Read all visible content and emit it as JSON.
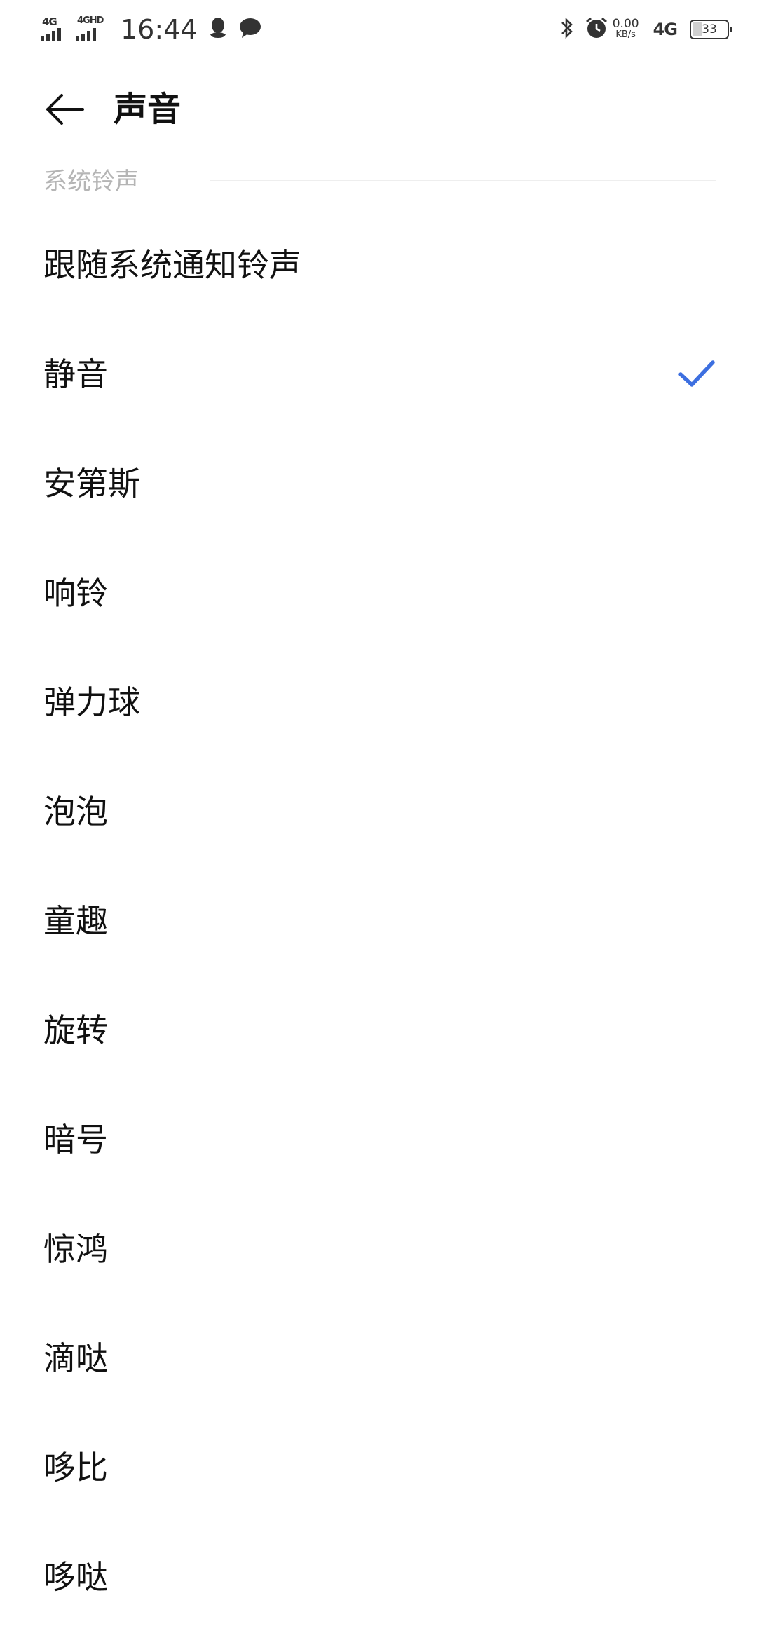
{
  "status_bar": {
    "sim1_net": "4G",
    "sim2_net": "4GHD",
    "time": "16:44",
    "speed_value": "0.00",
    "speed_unit": "KB/s",
    "net_type": "4G",
    "battery_level": "33",
    "icons": [
      "qq-icon",
      "message-icon",
      "bluetooth-icon",
      "alarm-icon"
    ]
  },
  "header": {
    "title": "声音"
  },
  "section": {
    "label": "系统铃声"
  },
  "ringtones": [
    {
      "label": "跟随系统通知铃声",
      "selected": false
    },
    {
      "label": "静音",
      "selected": true
    },
    {
      "label": "安第斯",
      "selected": false
    },
    {
      "label": "响铃",
      "selected": false
    },
    {
      "label": "弹力球",
      "selected": false
    },
    {
      "label": "泡泡",
      "selected": false
    },
    {
      "label": "童趣",
      "selected": false
    },
    {
      "label": "旋转",
      "selected": false
    },
    {
      "label": "暗号",
      "selected": false
    },
    {
      "label": "惊鸿",
      "selected": false
    },
    {
      "label": "滴哒",
      "selected": false
    },
    {
      "label": "哆比",
      "selected": false
    },
    {
      "label": "哆哒",
      "selected": false
    }
  ],
  "colors": {
    "accent": "#3d6fe0",
    "section_label": "#b5b5b5"
  }
}
